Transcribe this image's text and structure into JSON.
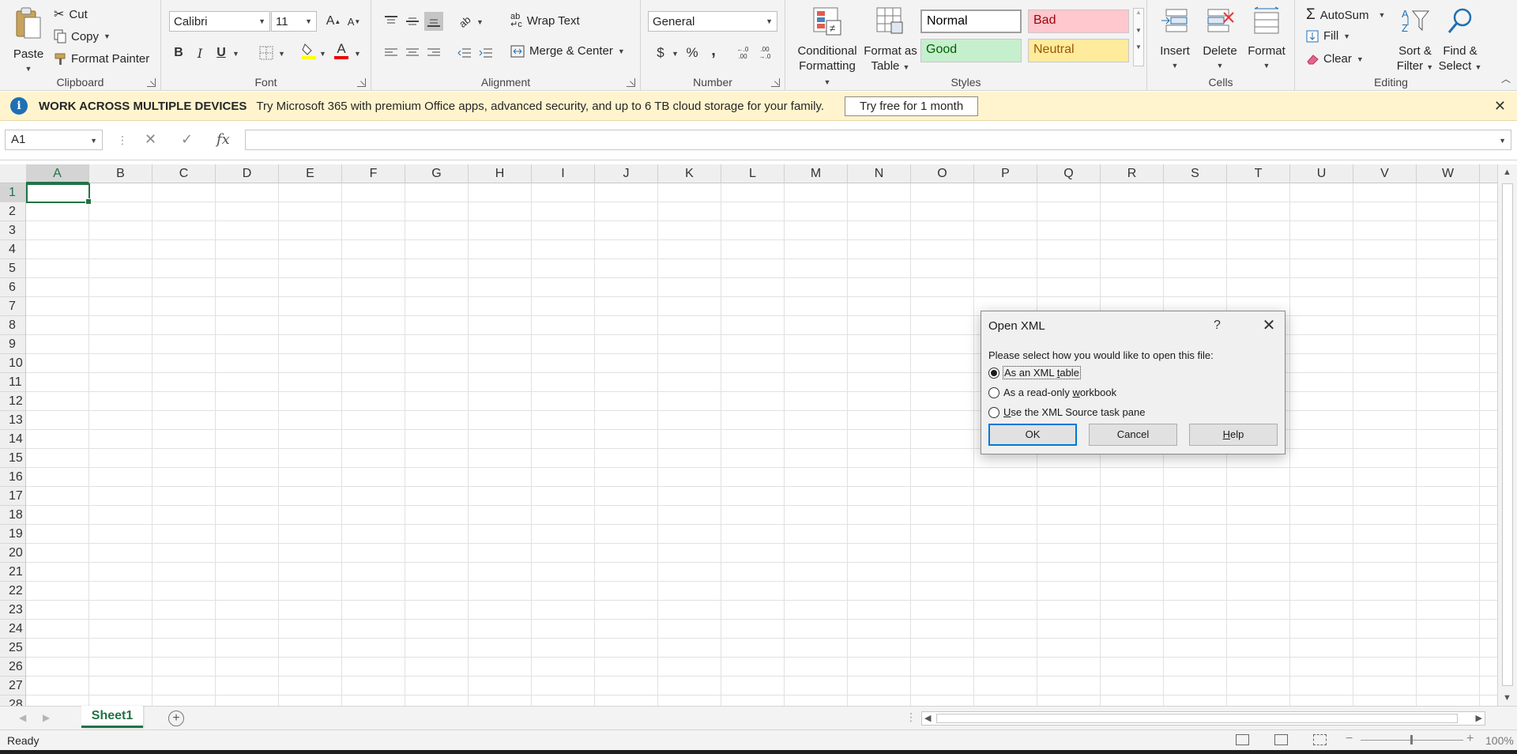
{
  "ribbon": {
    "clipboard": {
      "label": "Clipboard",
      "paste": "Paste",
      "cut": "Cut",
      "copy": "Copy",
      "format_painter": "Format Painter"
    },
    "font": {
      "label": "Font",
      "font_name": "Calibri",
      "font_size": "11",
      "bold": "B",
      "italic": "I",
      "underline": "U",
      "font_color_letter": "A",
      "grow": "A",
      "shrink": "A"
    },
    "alignment": {
      "label": "Alignment",
      "wrap_text": "Wrap Text",
      "merge_center": "Merge & Center"
    },
    "number": {
      "label": "Number",
      "format": "General",
      "currency": "$",
      "percent": "%",
      "comma": ",",
      "inc_decimal": "←.0 .00",
      "dec_decimal": ".00 →.0"
    },
    "styles": {
      "label": "Styles",
      "conditional_formatting_1": "Conditional",
      "conditional_formatting_2": "Formatting",
      "format_as_table_1": "Format as",
      "format_as_table_2": "Table",
      "normal": "Normal",
      "bad": "Bad",
      "good": "Good",
      "neutral": "Neutral"
    },
    "cells": {
      "label": "Cells",
      "insert": "Insert",
      "delete": "Delete",
      "format": "Format"
    },
    "editing": {
      "label": "Editing",
      "autosum": "AutoSum",
      "fill": "Fill",
      "clear": "Clear",
      "sort_filter_1": "Sort &",
      "sort_filter_2": "Filter",
      "find_select_1": "Find &",
      "find_select_2": "Select"
    }
  },
  "message_bar": {
    "title": "WORK ACROSS MULTIPLE DEVICES",
    "text": "Try Microsoft 365 with premium Office apps, advanced security, and up to 6 TB cloud storage for your family.",
    "button": "Try free for 1 month",
    "close": "✕",
    "info": "i"
  },
  "formula_bar": {
    "name_box": "A1",
    "fx": "fx",
    "cancel": "✕",
    "enter": "✓",
    "value": ""
  },
  "grid": {
    "columns": [
      "A",
      "B",
      "C",
      "D",
      "E",
      "F",
      "G",
      "H",
      "I",
      "J",
      "K",
      "L",
      "M",
      "N",
      "O",
      "P",
      "Q",
      "R",
      "S",
      "T",
      "U",
      "V",
      "W"
    ],
    "rows": [
      "1",
      "2",
      "3",
      "4",
      "5",
      "6",
      "7",
      "8",
      "9",
      "10",
      "11",
      "12",
      "13",
      "14",
      "15",
      "16",
      "17",
      "18",
      "19",
      "20",
      "21",
      "22",
      "23",
      "24",
      "25",
      "26",
      "27",
      "28"
    ],
    "selected_column": "A",
    "selected_row": "1"
  },
  "sheets": {
    "tabs": [
      "Sheet1"
    ],
    "add": "+"
  },
  "status": {
    "ready": "Ready",
    "zoom": "100%",
    "zoom_minus": "−",
    "zoom_plus": "+"
  },
  "dialog": {
    "title": "Open XML",
    "help_glyph": "?",
    "close_glyph": "✕",
    "prompt": "Please select how you would like to open this file:",
    "options": [
      {
        "pre": "As an XML ",
        "accel": "t",
        "post": "able",
        "checked": true
      },
      {
        "pre": "As a read-only ",
        "accel": "w",
        "post": "orkbook",
        "checked": false
      },
      {
        "pre": "",
        "accel": "U",
        "post": "se the XML Source task pane",
        "checked": false
      }
    ],
    "ok": "OK",
    "cancel": "Cancel",
    "help_pre": "",
    "help_accel": "H",
    "help_post": "elp"
  },
  "colors": {
    "excel_green": "#217346",
    "message_bg": "#fff4ce",
    "bad_bg": "#ffc7ce",
    "bad_fg": "#9c0006",
    "good_bg": "#c6efce",
    "good_fg": "#006100",
    "neutral_bg": "#ffeb9c",
    "neutral_fg": "#9c5700",
    "accent_blue": "#0078d7"
  },
  "icons": {
    "paste": "clipboard-icon",
    "cut": "scissors-icon",
    "copy": "copy-icon",
    "format_painter": "paintbrush-icon",
    "autosum": "sigma-icon",
    "fill": "fill-down-icon",
    "clear": "eraser-icon",
    "sort": "sort-filter-icon",
    "find": "magnifier-icon"
  }
}
